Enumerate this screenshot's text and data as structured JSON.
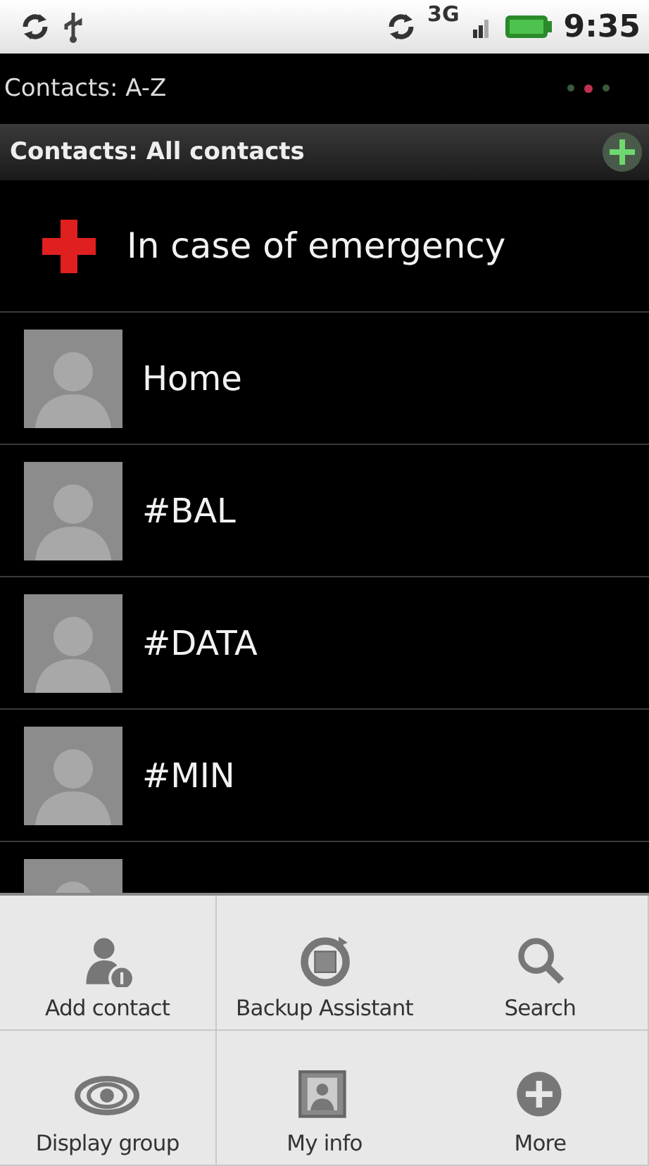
{
  "status_bar": {
    "network": "3G",
    "time": "9:35"
  },
  "title_bar": {
    "title": "Contacts: A-Z",
    "pages": [
      {
        "selected": false
      },
      {
        "selected": true
      },
      {
        "selected": false
      }
    ]
  },
  "header": {
    "title": "Contacts: All contacts"
  },
  "contacts": [
    {
      "kind": "emergency",
      "name": "In case of emergency"
    },
    {
      "kind": "contact",
      "name": "Home"
    },
    {
      "kind": "contact",
      "name": "#BAL"
    },
    {
      "kind": "contact",
      "name": "#DATA"
    },
    {
      "kind": "contact",
      "name": "#MIN"
    },
    {
      "kind": "contact"
    }
  ],
  "menu": [
    {
      "label": "Add contact"
    },
    {
      "label": "Backup Assistant"
    },
    {
      "label": "Search"
    },
    {
      "label": "Display group"
    },
    {
      "label": "My info"
    },
    {
      "label": "More"
    }
  ]
}
